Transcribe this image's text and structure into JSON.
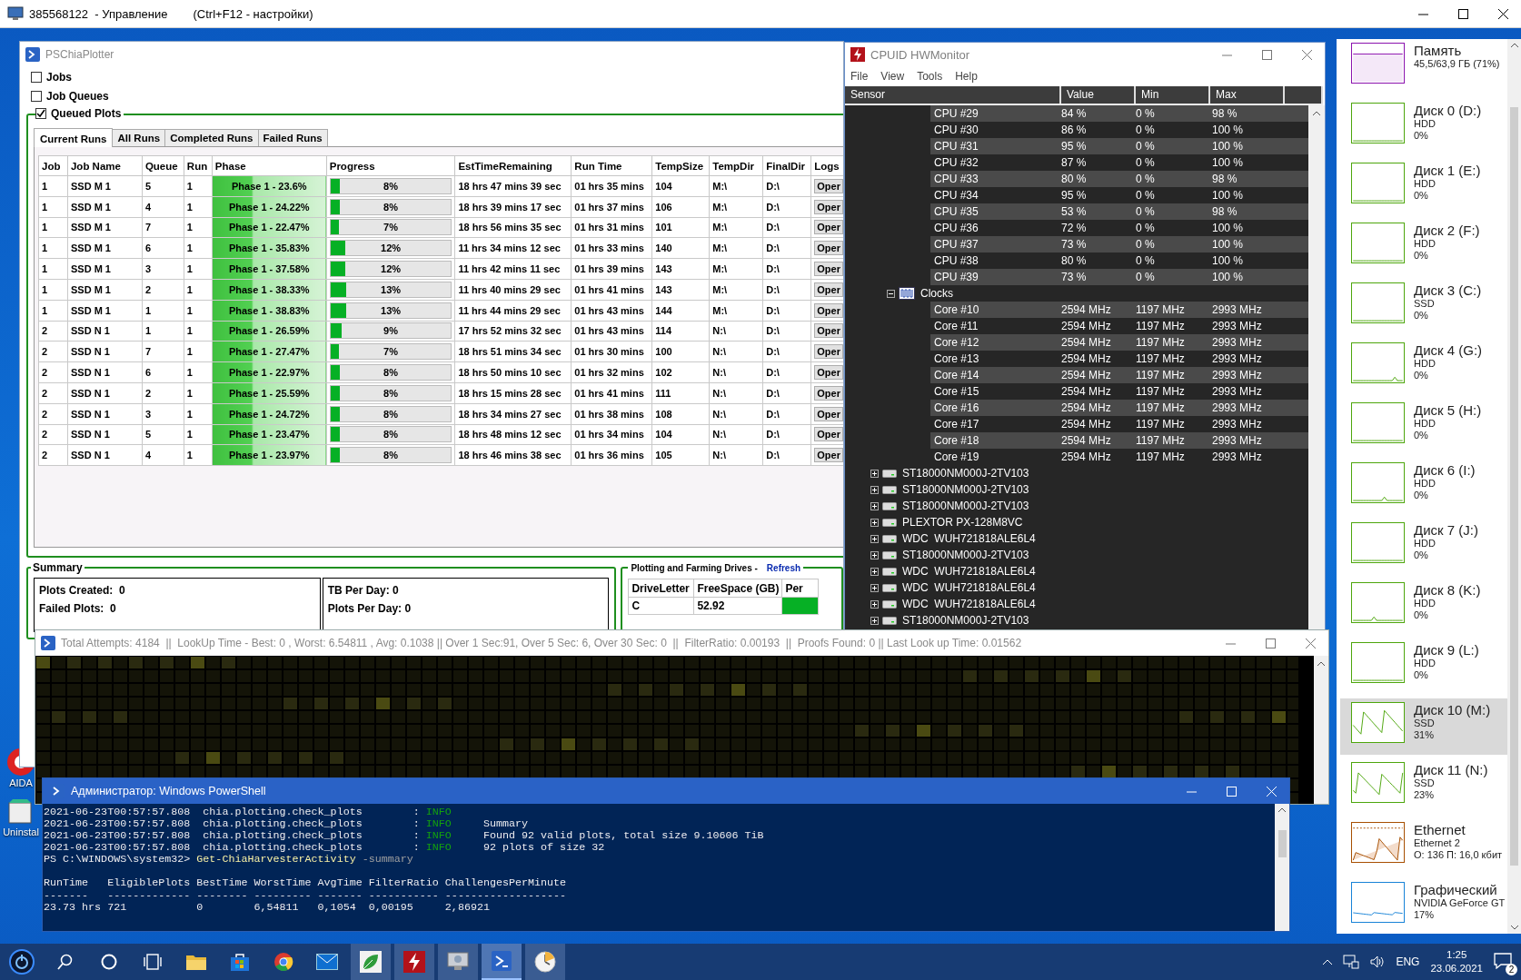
{
  "remote_title": {
    "text": "385568122  - Управление",
    "hint": "(Ctrl+F12 - настройки)"
  },
  "desktop_icons": [
    {
      "label": "AIDA"
    },
    {
      "label": "Uninstal"
    }
  ],
  "plotter": {
    "title": "PSChiaPlotter",
    "sections": [
      {
        "label": "Jobs",
        "checked": false
      },
      {
        "label": "Job Queues",
        "checked": false
      },
      {
        "label": "Queued Plots",
        "checked": true
      }
    ],
    "tabs": [
      {
        "label": "Current Runs",
        "selected": true
      },
      {
        "label": "All Runs",
        "selected": false
      },
      {
        "label": "Completed Runs",
        "selected": false
      },
      {
        "label": "Failed Runs",
        "selected": false
      }
    ],
    "columns": [
      {
        "label": "Job",
        "kind": "text"
      },
      {
        "label": "Job Name",
        "kind": "text"
      },
      {
        "label": "Queue",
        "kind": "text"
      },
      {
        "label": "Run",
        "kind": "text"
      },
      {
        "label": "Phase",
        "kind": "phase"
      },
      {
        "label": "Progress",
        "kind": "progress"
      },
      {
        "label": "EstTimeRemaining",
        "kind": "text"
      },
      {
        "label": "Run Time",
        "kind": "text"
      },
      {
        "label": "TempSize",
        "kind": "text"
      },
      {
        "label": "TempDir",
        "kind": "text"
      },
      {
        "label": "FinalDir",
        "kind": "text"
      },
      {
        "label": "Logs",
        "kind": "button"
      }
    ],
    "rows": [
      {
        "cells": [
          "1",
          "SSD M 1",
          "5",
          "1",
          "Phase 1 - 23.6%",
          "8%",
          "18 hrs 47 mins 39 sec",
          "01 hrs 35 mins",
          "104",
          "M:\\",
          "D:\\",
          "Oper"
        ],
        "level": 0.08
      },
      {
        "cells": [
          "1",
          "SSD M 1",
          "4",
          "1",
          "Phase 1 - 24.22%",
          "8%",
          "18 hrs 39 mins 17 sec",
          "01 hrs 37 mins",
          "106",
          "M:\\",
          "D:\\",
          "Oper"
        ],
        "level": 0.08
      },
      {
        "cells": [
          "1",
          "SSD M 1",
          "7",
          "1",
          "Phase 1 - 22.47%",
          "7%",
          "18 hrs 56 mins 35 sec",
          "01 hrs 31 mins",
          "101",
          "M:\\",
          "D:\\",
          "Oper"
        ],
        "level": 0.07
      },
      {
        "cells": [
          "1",
          "SSD M 1",
          "6",
          "1",
          "Phase 1 - 35.83%",
          "12%",
          "11 hrs 34 mins 12 sec",
          "01 hrs 33 mins",
          "140",
          "M:\\",
          "D:\\",
          "Oper"
        ],
        "level": 0.12
      },
      {
        "cells": [
          "1",
          "SSD M 1",
          "3",
          "1",
          "Phase 1 - 37.58%",
          "12%",
          "11 hrs 42 mins 11 sec",
          "01 hrs 39 mins",
          "143",
          "M:\\",
          "D:\\",
          "Oper"
        ],
        "level": 0.12
      },
      {
        "cells": [
          "1",
          "SSD M 1",
          "2",
          "1",
          "Phase 1 - 38.33%",
          "13%",
          "11 hrs 40 mins 29 sec",
          "01 hrs 41 mins",
          "143",
          "M:\\",
          "D:\\",
          "Oper"
        ],
        "level": 0.13
      },
      {
        "cells": [
          "1",
          "SSD M 1",
          "1",
          "1",
          "Phase 1 - 38.83%",
          "13%",
          "11 hrs 44 mins 29 sec",
          "01 hrs 43 mins",
          "144",
          "M:\\",
          "D:\\",
          "Oper"
        ],
        "level": 0.13
      },
      {
        "cells": [
          "2",
          "SSD N 1",
          "1",
          "1",
          "Phase 1 - 26.59%",
          "9%",
          "17 hrs 52 mins 32 sec",
          "01 hrs 43 mins",
          "114",
          "N:\\",
          "D:\\",
          "Oper"
        ],
        "level": 0.09
      },
      {
        "cells": [
          "2",
          "SSD N 1",
          "7",
          "1",
          "Phase 1 - 27.47%",
          "7%",
          "18 hrs 51 mins 34 sec",
          "01 hrs 30 mins",
          "100",
          "N:\\",
          "D:\\",
          "Oper"
        ],
        "level": 0.07
      },
      {
        "cells": [
          "2",
          "SSD N 1",
          "6",
          "1",
          "Phase 1 - 22.97%",
          "8%",
          "18 hrs 50 mins 10 sec",
          "01 hrs 32 mins",
          "102",
          "N:\\",
          "D:\\",
          "Oper"
        ],
        "level": 0.08
      },
      {
        "cells": [
          "2",
          "SSD N 1",
          "2",
          "1",
          "Phase 1 - 25.59%",
          "8%",
          "18 hrs 15 mins 28 sec",
          "01 hrs 41 mins",
          "111",
          "N:\\",
          "D:\\",
          "Oper"
        ],
        "level": 0.08
      },
      {
        "cells": [
          "2",
          "SSD N 1",
          "3",
          "1",
          "Phase 1 - 24.72%",
          "8%",
          "18 hrs 34 mins 27 sec",
          "01 hrs 38 mins",
          "108",
          "N:\\",
          "D:\\",
          "Oper"
        ],
        "level": 0.08
      },
      {
        "cells": [
          "2",
          "SSD N 1",
          "5",
          "1",
          "Phase 1 - 23.47%",
          "8%",
          "18 hrs 48 mins 12 sec",
          "01 hrs 34 mins",
          "104",
          "N:\\",
          "D:\\",
          "Oper"
        ],
        "level": 0.08
      },
      {
        "cells": [
          "2",
          "SSD N 1",
          "4",
          "1",
          "Phase 1 - 23.97%",
          "8%",
          "18 hrs 46 mins 38 sec",
          "01 hrs 36 mins",
          "105",
          "N:\\",
          "D:\\",
          "Oper"
        ],
        "level": 0.08
      }
    ],
    "summary": {
      "title": "Summary",
      "boxes": [
        [
          "Plots Created:  0",
          "Failed Plots:  0"
        ],
        [
          "TB Per Day: 0",
          "Plots Per Day: 0"
        ]
      ]
    },
    "drives": {
      "title": "Plotting and Farming Drives -",
      "refresh": "Refresh",
      "columns": [
        "DriveLetter",
        "FreeSpace (GB)",
        "Per"
      ],
      "rows": [
        [
          "C",
          "52.92"
        ]
      ]
    }
  },
  "hwmonitor": {
    "title": "CPUID HWMonitor",
    "menu": [
      "File",
      "View",
      "Tools",
      "Help"
    ],
    "columns": [
      "Sensor",
      "Value",
      "Min",
      "Max"
    ],
    "cpu_rows": [
      {
        "label": "CPU #29",
        "value": "84 %",
        "min": "0 %",
        "max": "98 %"
      },
      {
        "label": "CPU #30",
        "value": "86 %",
        "min": "0 %",
        "max": "100 %"
      },
      {
        "label": "CPU #31",
        "value": "95 %",
        "min": "0 %",
        "max": "100 %"
      },
      {
        "label": "CPU #32",
        "value": "87 %",
        "min": "0 %",
        "max": "100 %"
      },
      {
        "label": "CPU #33",
        "value": "80 %",
        "min": "0 %",
        "max": "98 %"
      },
      {
        "label": "CPU #34",
        "value": "95 %",
        "min": "0 %",
        "max": "100 %"
      },
      {
        "label": "CPU #35",
        "value": "53 %",
        "min": "0 %",
        "max": "98 %"
      },
      {
        "label": "CPU #36",
        "value": "72 %",
        "min": "0 %",
        "max": "100 %"
      },
      {
        "label": "CPU #37",
        "value": "73 %",
        "min": "0 %",
        "max": "100 %"
      },
      {
        "label": "CPU #38",
        "value": "80 %",
        "min": "0 %",
        "max": "100 %"
      },
      {
        "label": "CPU #39",
        "value": "73 %",
        "min": "0 %",
        "max": "100 %"
      }
    ],
    "clocks": {
      "label": "Clocks",
      "expanded": true,
      "children": [
        {
          "label": "Core #10",
          "value": "2594 MHz",
          "min": "1197 MHz",
          "max": "2993 MHz"
        },
        {
          "label": "Core #11",
          "value": "2594 MHz",
          "min": "1197 MHz",
          "max": "2993 MHz"
        },
        {
          "label": "Core #12",
          "value": "2594 MHz",
          "min": "1197 MHz",
          "max": "2993 MHz"
        },
        {
          "label": "Core #13",
          "value": "2594 MHz",
          "min": "1197 MHz",
          "max": "2993 MHz"
        },
        {
          "label": "Core #14",
          "value": "2594 MHz",
          "min": "1197 MHz",
          "max": "2993 MHz"
        },
        {
          "label": "Core #15",
          "value": "2594 MHz",
          "min": "1197 MHz",
          "max": "2993 MHz"
        },
        {
          "label": "Core #16",
          "value": "2594 MHz",
          "min": "1197 MHz",
          "max": "2993 MHz"
        },
        {
          "label": "Core #17",
          "value": "2594 MHz",
          "min": "1197 MHz",
          "max": "2993 MHz"
        },
        {
          "label": "Core #18",
          "value": "2594 MHz",
          "min": "1197 MHz",
          "max": "2993 MHz"
        },
        {
          "label": "Core #19",
          "value": "2594 MHz",
          "min": "1197 MHz",
          "max": "2993 MHz"
        }
      ]
    },
    "devices": [
      {
        "label": "ST18000NM000J-2TV103",
        "expanded": false
      },
      {
        "label": "ST18000NM000J-2TV103",
        "expanded": false
      },
      {
        "label": "ST18000NM000J-2TV103",
        "expanded": false
      },
      {
        "label": "PLEXTOR PX-128M8VC",
        "expanded": false
      },
      {
        "label": "WDC  WUH721818ALE6L4",
        "expanded": false
      },
      {
        "label": "ST18000NM000J-2TV103",
        "expanded": false
      },
      {
        "label": "WDC  WUH721818ALE6L4",
        "expanded": false
      },
      {
        "label": "WDC  WUH721818ALE6L4",
        "expanded": false
      },
      {
        "label": "WDC  WUH721818ALE6L4",
        "expanded": false
      },
      {
        "label": "ST18000NM000J-2TV103",
        "expanded": false
      }
    ]
  },
  "taskmgr": {
    "items": [
      {
        "kind": "memory",
        "title": "Память",
        "lines": [
          "45,5/63,9 ГБ (71%)"
        ],
        "color": "#8b12ae",
        "selected": false
      },
      {
        "kind": "disk",
        "title": "Диск 0 (D:)",
        "lines": [
          "HDD",
          "0%"
        ],
        "color": "#4da60c",
        "selected": false
      },
      {
        "kind": "disk",
        "title": "Диск 1 (E:)",
        "lines": [
          "HDD",
          "0%"
        ],
        "color": "#4da60c",
        "selected": false
      },
      {
        "kind": "disk",
        "title": "Диск 2 (F:)",
        "lines": [
          "HDD",
          "0%"
        ],
        "color": "#4da60c",
        "selected": false
      },
      {
        "kind": "disk",
        "title": "Диск 3 (C:)",
        "lines": [
          "SSD",
          "0%"
        ],
        "color": "#4da60c",
        "selected": false
      },
      {
        "kind": "disk",
        "title": "Диск 4 (G:)",
        "lines": [
          "HDD",
          "0%"
        ],
        "color": "#4da60c",
        "selected": false
      },
      {
        "kind": "disk",
        "title": "Диск 5 (H:)",
        "lines": [
          "HDD",
          "0%"
        ],
        "color": "#4da60c",
        "selected": false
      },
      {
        "kind": "disk",
        "title": "Диск 6 (I:)",
        "lines": [
          "HDD",
          "0%"
        ],
        "color": "#4da60c",
        "selected": false
      },
      {
        "kind": "disk",
        "title": "Диск 7 (J:)",
        "lines": [
          "HDD",
          "0%"
        ],
        "color": "#4da60c",
        "selected": false
      },
      {
        "kind": "disk",
        "title": "Диск 8 (K:)",
        "lines": [
          "HDD",
          "0%"
        ],
        "color": "#4da60c",
        "selected": false
      },
      {
        "kind": "disk",
        "title": "Диск 9 (L:)",
        "lines": [
          "HDD",
          "0%"
        ],
        "color": "#4da60c",
        "selected": false
      },
      {
        "kind": "disk",
        "title": "Диск 10 (M:)",
        "lines": [
          "SSD",
          "31%"
        ],
        "color": "#4da60c",
        "selected": true
      },
      {
        "kind": "disk",
        "title": "Диск 11 (N:)",
        "lines": [
          "SSD",
          "23%"
        ],
        "color": "#4da60c",
        "selected": false
      },
      {
        "kind": "network",
        "title": "Ethernet",
        "lines": [
          "Ethernet 2",
          "О: 136 П: 16,0 кбит"
        ],
        "color": "#a74f01",
        "selected": false
      },
      {
        "kind": "gpu",
        "title": "Графический",
        "lines": [
          "NVIDIA GeForce GT",
          "17%"
        ],
        "color": "#1883d7",
        "selected": false
      }
    ]
  },
  "harvester": {
    "title": "Total Attempts: 4184  ||  LookUp Time - Best: 0 , Worst: 6.54811 , Avg: 0.1038 || Over 1 Sec:91, Over 5 Sec: 6, Over 30 Sec: 0  ||  FilterRatio: 0.00193  ||  Proofs Found: 0 || Last Look up Time: 0.01562"
  },
  "powershell": {
    "title": "Администратор: Windows PowerShell",
    "lines": [
      {
        "segments": [
          {
            "text": "2021-06-23T00:57:57.808  chia.plotting.check_plots        : ",
            "kind": "plain"
          },
          {
            "text": "INFO",
            "kind": "info"
          }
        ]
      },
      {
        "segments": [
          {
            "text": "2021-06-23T00:57:57.808  chia.plotting.check_plots        : ",
            "kind": "plain"
          },
          {
            "text": "INFO",
            "kind": "info"
          },
          {
            "text": "     Summary",
            "kind": "plain"
          }
        ]
      },
      {
        "segments": [
          {
            "text": "2021-06-23T00:57:57.808  chia.plotting.check_plots        : ",
            "kind": "plain"
          },
          {
            "text": "INFO",
            "kind": "info"
          },
          {
            "text": "     Found 92 valid plots, total size 9.10606 TiB",
            "kind": "plain"
          }
        ]
      },
      {
        "segments": [
          {
            "text": "2021-06-23T00:57:57.808  chia.plotting.check_plots        : ",
            "kind": "plain"
          },
          {
            "text": "INFO",
            "kind": "info"
          },
          {
            "text": "     92 plots of size 32",
            "kind": "plain"
          }
        ]
      },
      {
        "segments": [
          {
            "text": "PS C:\\WINDOWS\\system32> ",
            "kind": "plain"
          },
          {
            "text": "Get-ChiaHarvesterActivity",
            "kind": "command"
          },
          {
            "text": " -summary",
            "kind": "parameter"
          }
        ]
      },
      {
        "segments": [
          {
            "text": "RunTime   EligiblePlots BestTime WorstTime AvgTime FilterRatio ChallengesPerMinute",
            "kind": "plain"
          }
        ],
        "spaced": true
      },
      {
        "segments": [
          {
            "text": "-------   ------------- -------- --------- ------- ----------- -------------------",
            "kind": "plain"
          }
        ]
      },
      {
        "segments": [
          {
            "text": "23.73 hrs 721           0        6,54811   0,1054  0,00195     2,86921",
            "kind": "plain"
          }
        ]
      }
    ]
  },
  "taskbar": {
    "apps": [
      {
        "kind": "start",
        "running": false,
        "selected": false
      },
      {
        "kind": "search",
        "running": false,
        "selected": false
      },
      {
        "kind": "cortana",
        "running": false,
        "selected": false
      },
      {
        "kind": "taskview",
        "running": false,
        "selected": false
      },
      {
        "kind": "explorer",
        "running": false,
        "selected": false
      },
      {
        "kind": "store",
        "running": false,
        "selected": false
      },
      {
        "kind": "browser",
        "running": false,
        "selected": false
      },
      {
        "kind": "mail",
        "running": false,
        "selected": false
      },
      {
        "kind": "leaf",
        "running": true,
        "selected": false
      },
      {
        "kind": "bolt",
        "running": true,
        "selected": false
      },
      {
        "kind": "monitor",
        "running": true,
        "selected": false
      },
      {
        "kind": "terminal",
        "running": true,
        "selected": true
      },
      {
        "kind": "clock",
        "running": true,
        "selected": false
      }
    ],
    "tray": {
      "lang": "ENG",
      "time": "1:25",
      "date": "23.06.2021",
      "notifications": "2"
    }
  }
}
